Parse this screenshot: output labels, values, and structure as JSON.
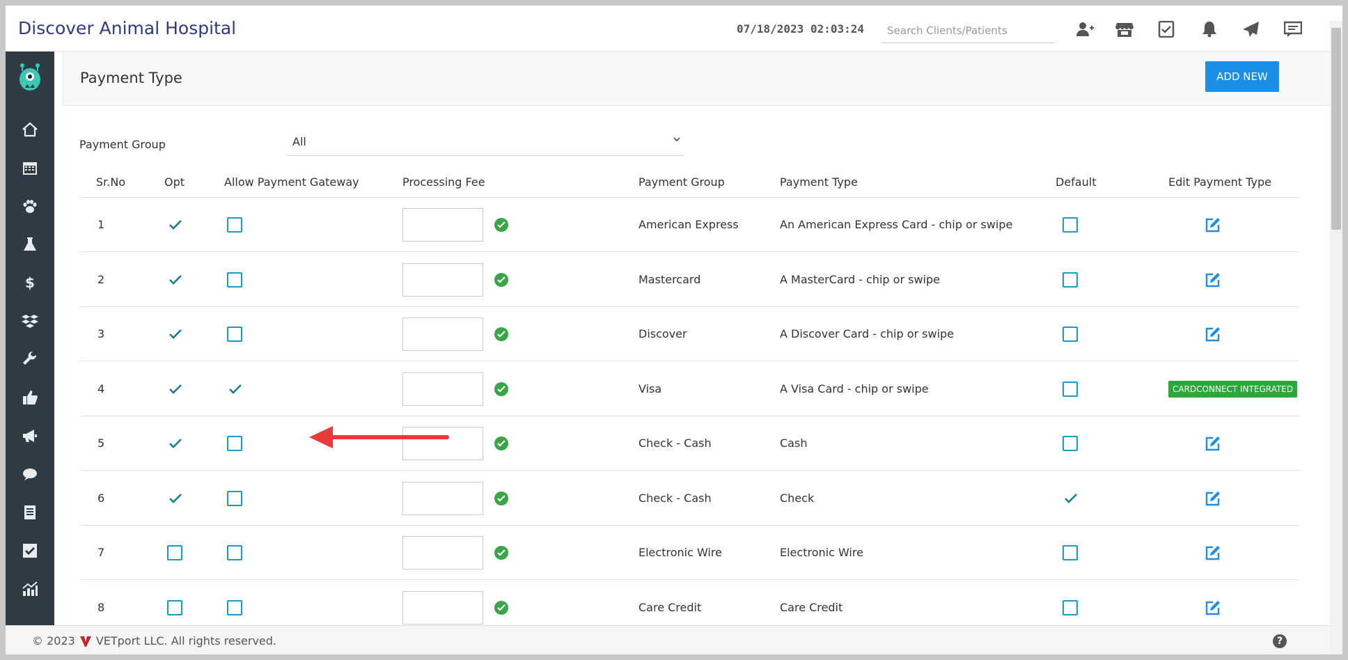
{
  "header": {
    "app_title": "Discover Animal Hospital",
    "datetime": "07/18/2023 02:03:24",
    "search_placeholder": "Search Clients/Patients",
    "icons": [
      "add-user-icon",
      "store-icon",
      "task-check-icon",
      "bell-icon",
      "send-icon",
      "chat-icon"
    ]
  },
  "sidebar": {
    "icons": [
      "home-icon",
      "calendar-icon",
      "paw-icon",
      "flask-icon",
      "dollar-icon",
      "boxes-icon",
      "wrench-icon",
      "thumbs-up-icon",
      "megaphone-icon",
      "comments-icon",
      "ledger-icon",
      "checkbox-icon",
      "chart-icon"
    ]
  },
  "page": {
    "title": "Payment Type",
    "add_button": "ADD NEW",
    "filter_label": "Payment Group",
    "filter_value": "All"
  },
  "table": {
    "columns": [
      "Sr.No",
      "Opt",
      "Allow Payment Gateway",
      "Processing Fee",
      "Payment Group",
      "Payment Type",
      "Default",
      "Edit Payment Type"
    ],
    "rows": [
      {
        "sr": "1",
        "opt": true,
        "gateway": false,
        "group": "American Express",
        "type": "An American Express Card - chip or swipe",
        "default": false,
        "edit": "icon"
      },
      {
        "sr": "2",
        "opt": true,
        "gateway": false,
        "group": "Mastercard",
        "type": "A MasterCard - chip or swipe",
        "default": false,
        "edit": "icon"
      },
      {
        "sr": "3",
        "opt": true,
        "gateway": false,
        "group": "Discover",
        "type": "A Discover Card - chip or swipe",
        "default": false,
        "edit": "icon"
      },
      {
        "sr": "4",
        "opt": true,
        "gateway": true,
        "group": "Visa",
        "type": "A Visa Card - chip or swipe",
        "default": false,
        "edit": "CARDCONNECT INTEGRATED"
      },
      {
        "sr": "5",
        "opt": true,
        "gateway": false,
        "group": "Check - Cash",
        "type": "Cash",
        "default": false,
        "edit": "icon"
      },
      {
        "sr": "6",
        "opt": true,
        "gateway": false,
        "group": "Check - Cash",
        "type": "Check",
        "default": true,
        "edit": "icon"
      },
      {
        "sr": "7",
        "opt": false,
        "gateway": false,
        "group": "Electronic Wire",
        "type": "Electronic Wire",
        "default": false,
        "edit": "icon"
      },
      {
        "sr": "8",
        "opt": false,
        "gateway": false,
        "group": "Care Credit",
        "type": "Care Credit",
        "default": false,
        "edit": "icon"
      }
    ]
  },
  "footer": {
    "copyright": "© 2023",
    "company": "VETport LLC. All rights reserved."
  },
  "colors": {
    "accent": "#1a8fe5",
    "sidebar": "#2e3b44",
    "success": "#3aa548",
    "title": "#2f3a80",
    "annotation_arrow": "#e83a3a"
  }
}
